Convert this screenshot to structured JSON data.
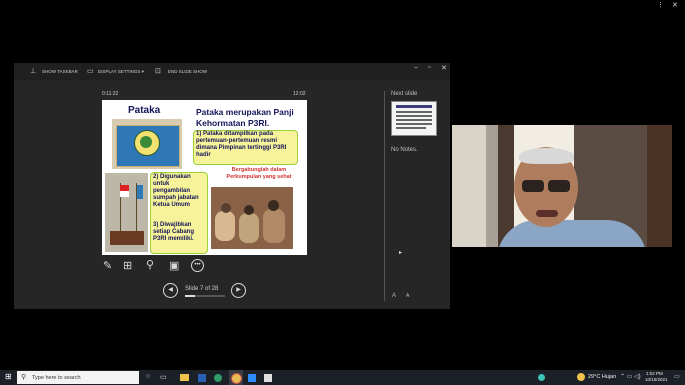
{
  "presenter": {
    "toolbar": {
      "show_taskbar": "SHOW TASKBAR",
      "display_settings": "DISPLAY SETTINGS ▾",
      "end_slide_show": "END SLIDE SHOW"
    },
    "timer": "0:11:22",
    "clock": "12:02",
    "next_slide_label": "Next slide",
    "notes": "No Notes.",
    "slide_counter": "Slide 7 of 28"
  },
  "slide": {
    "title_left": "Pataka",
    "title_right": "Pataka  merupakan Panji Kehormatan P3RI.",
    "point1": "1)  Pataka ditampilkan pada pertemuan-pertemuan resmi dimana Pimpinan tertinggi P3RI hadir",
    "point2": "2)  Digunakan untuk pengambilan sumpah jabatan Ketua Umum",
    "point3": "3)  Diwajibkan setiap Cabang P3RI memiliki.",
    "motto": "Bergabunglah dalam Perkumpulan yang sehat"
  },
  "taskbar": {
    "search_placeholder": "Type here to search",
    "weather": "29°C  Hujan",
    "time": "1:02 PM",
    "date": "10/15/2021"
  },
  "colors": {
    "slide_title": "#14145a",
    "panel_fill": "#f6f39a",
    "panel_border": "#9bd23a",
    "motto": "#d23232"
  }
}
